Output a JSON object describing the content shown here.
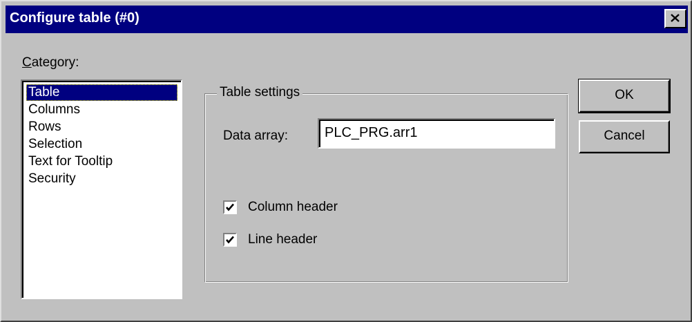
{
  "window": {
    "title": "Configure table (#0)",
    "close_icon": "close-icon"
  },
  "category": {
    "label_accel": "C",
    "label_rest": "ategory:",
    "items": [
      {
        "label": "Table",
        "selected": true
      },
      {
        "label": "Columns",
        "selected": false
      },
      {
        "label": "Rows",
        "selected": false
      },
      {
        "label": "Selection",
        "selected": false
      },
      {
        "label": "Text for Tooltip",
        "selected": false
      },
      {
        "label": "Security",
        "selected": false
      }
    ]
  },
  "settings": {
    "group_title": "Table settings",
    "data_array_label": "Data array:",
    "data_array_value": "PLC_PRG.arr1",
    "column_header_label": "Column header",
    "column_header_checked": true,
    "line_header_label": "Line header",
    "line_header_checked": true
  },
  "buttons": {
    "ok": "OK",
    "cancel": "Cancel"
  },
  "colors": {
    "titlebar": "#000080",
    "face": "#c0c0c0",
    "selection": "#000080"
  }
}
